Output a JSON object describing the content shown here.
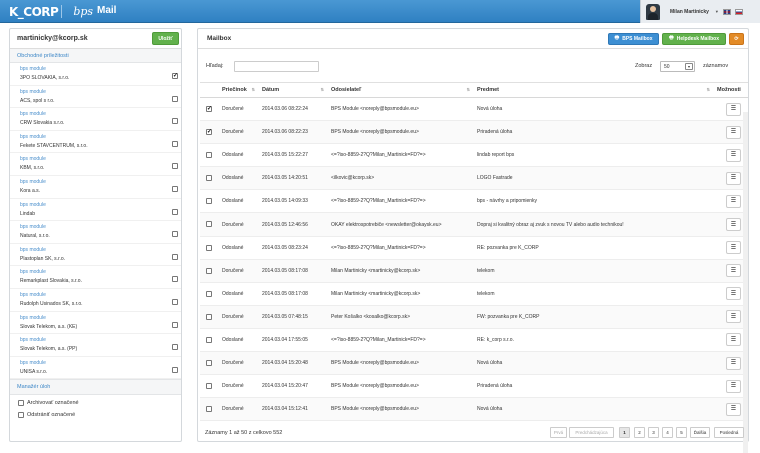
{
  "header": {
    "logo_k": "K_CORP",
    "logo_bps": "bps",
    "app_title": "Mail",
    "user_name": "Milan Martinicky"
  },
  "left": {
    "email": "martinicky@kcorp.sk",
    "save_label": "Uložiť",
    "section1": "Obchodné príležitosti",
    "modules": [
      {
        "module": "bps module",
        "name": "3PO SLOVAKIA, s.r.o.",
        "checked": true
      },
      {
        "module": "bps module",
        "name": "ACS, spol s r.o.",
        "checked": false
      },
      {
        "module": "bps module",
        "name": "CRW Slovakia s.r.o.",
        "checked": false
      },
      {
        "module": "bps module",
        "name": "Fekete STAVCENTRUM, s.r.o.",
        "checked": false
      },
      {
        "module": "bps module",
        "name": "KBM, s.r.o.",
        "checked": false
      },
      {
        "module": "bps module",
        "name": "Kora a.s.",
        "checked": false
      },
      {
        "module": "bps module",
        "name": "Lindab",
        "checked": false
      },
      {
        "module": "bps module",
        "name": "Natural, s.r.o.",
        "checked": false
      },
      {
        "module": "bps module",
        "name": "Plastoplan SK, s.r.o.",
        "checked": false
      },
      {
        "module": "bps module",
        "name": "Remarkplast Slovakia, s.r.o.",
        "checked": false
      },
      {
        "module": "bps module",
        "name": "Rudolph Usinados SK, s.r.o.",
        "checked": false
      },
      {
        "module": "bps module",
        "name": "Slovak Telekom, a.s. (KE)",
        "checked": false
      },
      {
        "module": "bps module",
        "name": "Slovak Telekom, a.s. (PP)",
        "checked": false
      },
      {
        "module": "bps module",
        "name": "UNISA s.r.o.",
        "checked": false
      }
    ],
    "section2": "Manažér úloh",
    "opt_archive": "Archivovať označené",
    "opt_delete": "Odstrániť označené"
  },
  "right": {
    "title": "Mailbox",
    "btn_bps": "BPS Mailbox",
    "btn_help": "Helpdesk Mailbox",
    "search_label": "Hľadaj:",
    "show_label": "Zobraz",
    "page_size": "50",
    "records_label": "záznamov",
    "columns": [
      "Priečinok",
      "Dátum",
      "Odosielateľ",
      "Predmet",
      "Možnosti"
    ],
    "rows": [
      {
        "checked": true,
        "folder": "Doručené",
        "date": "2014.03.06 08:22:24",
        "from": "BPS Module <noreply@bpsmodule.eu>",
        "subject": "Nová úloha"
      },
      {
        "checked": true,
        "folder": "Doručené",
        "date": "2014.03.06 08:22:23",
        "from": "BPS Module <noreply@bpsmodule.eu>",
        "subject": "Priradená úloha"
      },
      {
        "checked": false,
        "folder": "Odoslané",
        "date": "2014.03.05 15:22:27",
        "from": "<=?iso-8859-2?Q?Milan_Martinick=FD?=>",
        "subject": "lindab report bps"
      },
      {
        "checked": false,
        "folder": "Odoslané",
        "date": "2014.03.05 14:20:51",
        "from": "<ilkovic@kcorp.sk>",
        "subject": "LOGO Fastrade"
      },
      {
        "checked": false,
        "folder": "Odoslané",
        "date": "2014.03.05 14:09:33",
        "from": "<=?iso-8859-2?Q?Milan_Martinick=FD?=>",
        "subject": "bps - návrhy a pripomienky"
      },
      {
        "checked": false,
        "folder": "Doručené",
        "date": "2014.03.05 12:46:56",
        "from": "OKAY elektrospotrebiče <newsletter@okaysk.eu>",
        "subject": "Dopraj si kvalitný obraz aj zvuk s novou TV alebo audio technikou!"
      },
      {
        "checked": false,
        "folder": "Odoslané",
        "date": "2014.03.05 08:23:24",
        "from": "<=?iso-8859-2?Q?Milan_Martinick=FD?=>",
        "subject": "RE: pozvanka pre K_CORP"
      },
      {
        "checked": false,
        "folder": "Doručené",
        "date": "2014.03.05 08:17:08",
        "from": "Milan Martinicky <martinicky@kcorp.sk>",
        "subject": "telekom"
      },
      {
        "checked": false,
        "folder": "Odoslané",
        "date": "2014.03.05 08:17:08",
        "from": "Milan Martinicky <martinicky@kcorp.sk>",
        "subject": "telekom"
      },
      {
        "checked": false,
        "folder": "Doručené",
        "date": "2014.03.05 07:48:15",
        "from": "Peter Košalko <kosalko@kcorp.sk>",
        "subject": "FW: pozvanka pre K_CORP"
      },
      {
        "checked": false,
        "folder": "Odoslané",
        "date": "2014.03.04 17:55:05",
        "from": "<=?iso-8859-2?Q?Milan_Martinick=FD?=>",
        "subject": "RE: k_corp s.r.o."
      },
      {
        "checked": false,
        "folder": "Doručené",
        "date": "2014.03.04 15:20:48",
        "from": "BPS Module <noreply@bpsmodule.eu>",
        "subject": "Nová úloha"
      },
      {
        "checked": false,
        "folder": "Doručené",
        "date": "2014.03.04 15:20:47",
        "from": "BPS Module <noreply@bpsmodule.eu>",
        "subject": "Priradená úloha"
      },
      {
        "checked": false,
        "folder": "Doručené",
        "date": "2014.03.04 15:12:41",
        "from": "BPS Module <noreply@bpsmodule.eu>",
        "subject": "Nová úloha"
      }
    ],
    "info": "Záznamy 1 až 50 z celkovo 552",
    "pager": {
      "first": "Prvá",
      "prev": "Predchádzajúca",
      "pages": [
        "1",
        "2",
        "3",
        "4",
        "5"
      ],
      "next": "Ďalšia",
      "last": "Posledná"
    }
  }
}
